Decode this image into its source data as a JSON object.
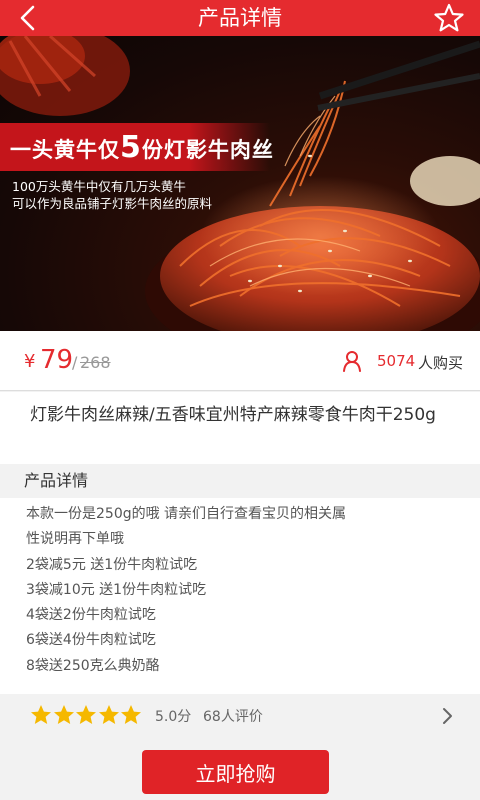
{
  "header": {
    "title": "产品详情",
    "back_icon": "chevron-left-icon",
    "favorite_icon": "star-outline-icon"
  },
  "hero": {
    "slogan_part1": "一头黄牛仅",
    "slogan_number": "5",
    "slogan_part2": "份灯影牛肉丝",
    "desc_line1": "100万头黄牛中仅有几万头黄牛",
    "desc_line2": "可以作为良品铺子灯影牛肉丝的原料"
  },
  "price": {
    "currency": "¥",
    "current": "79",
    "separator": "/",
    "original": "268",
    "buyers_count": "5074",
    "buyers_label": "人购买"
  },
  "product": {
    "name": "灯影牛肉丝麻辣/五香味宜州特产麻辣零食牛肉干250g"
  },
  "details": {
    "section_title": "产品详情",
    "lines": [
      "本款一份是250g的哦 请亲们自行查看宝贝的相关属",
      "性说明再下单哦",
      "2袋减5元 送1份牛肉粒试吃",
      "3袋减10元 送1份牛肉粒试吃",
      "4袋送2份牛肉粒试吃",
      "6袋送4份牛肉粒试吃",
      "8袋送250克么典奶酪"
    ]
  },
  "rating": {
    "stars": 5,
    "score": "5.0分",
    "reviews": "68人评价"
  },
  "actions": {
    "buy_label": "立即抢购"
  },
  "colors": {
    "brand_red": "#e52b2f",
    "star_yellow": "#f5b800"
  }
}
